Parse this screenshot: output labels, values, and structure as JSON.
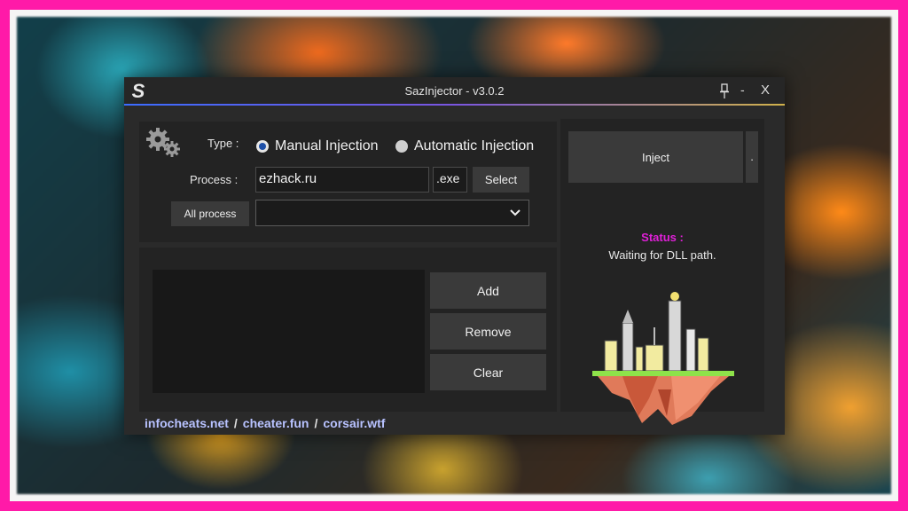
{
  "window": {
    "title": "SazInjector - v3.0.2",
    "logo_letter": "S",
    "pin_icon": "pin-icon",
    "minimize_label": "-",
    "close_label": "X"
  },
  "injection": {
    "type_label": "Type :",
    "manual_label": "Manual Injection",
    "automatic_label": "Automatic Injection",
    "selected": "manual",
    "process_label": "Process :",
    "process_value": "ezhack.ru",
    "exe_suffix": ".exe",
    "select_label": "Select",
    "all_process_label": "All process",
    "process_dropdown_value": ""
  },
  "dll_list": {
    "items": [],
    "add_label": "Add",
    "remove_label": "Remove",
    "clear_label": "Clear"
  },
  "side": {
    "inject_label": "Inject",
    "dots": [
      ".",
      ".",
      "."
    ],
    "status_label": "Status :",
    "status_text": "Waiting for DLL path."
  },
  "footer": {
    "links": [
      "infocheats.net",
      "cheater.fun",
      "corsair.wtf"
    ],
    "separator": "/"
  },
  "colors": {
    "frame": "#ff1aa8",
    "status_title": "#e020d8",
    "footer_links": "#b8c2ff",
    "window_bg": "#2a2a2a",
    "panel_bg": "#232323"
  }
}
